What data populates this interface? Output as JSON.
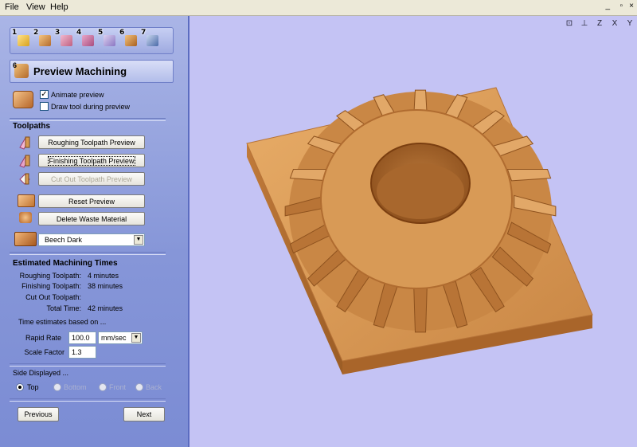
{
  "menu": {
    "items": [
      {
        "label": "File"
      },
      {
        "label": "View"
      },
      {
        "label": "Help"
      }
    ]
  },
  "toolbar": {
    "buttons": [
      {
        "number": "1",
        "icon": "open-file-icon"
      },
      {
        "number": "2",
        "icon": "job-setup-icon"
      },
      {
        "number": "3",
        "icon": "model-icon"
      },
      {
        "number": "4",
        "icon": "roughing-icon"
      },
      {
        "number": "5",
        "icon": "finishing-icon"
      },
      {
        "number": "6",
        "icon": "preview-icon"
      },
      {
        "number": "7",
        "icon": "save-icon"
      }
    ]
  },
  "header": {
    "number": "6",
    "title": "Preview Machining"
  },
  "options": {
    "animate_label": "Animate preview",
    "animate_checked": true,
    "draw_tool_label": "Draw tool during preview",
    "draw_tool_checked": false
  },
  "toolpaths": {
    "title": "Toolpaths",
    "roughing": "Roughing Toolpath Preview",
    "finishing": "Finishing Toolpath Preview",
    "cutout": "Cut Out Toolpath Preview",
    "reset": "Reset Preview",
    "delete_waste": "Delete Waste Material",
    "material": "Beech Dark"
  },
  "times": {
    "title": "Estimated Machining Times",
    "rows": [
      {
        "label": "Roughing Toolpath:",
        "value": "4 minutes"
      },
      {
        "label": "Finishing Toolpath:",
        "value": "38 minutes"
      },
      {
        "label": "Cut Out Toolpath:",
        "value": ""
      },
      {
        "label": "Total Time:",
        "value": "42 minutes"
      }
    ],
    "based_on": "Time estimates based on ...",
    "rapid_label": "Rapid Rate",
    "rapid_value": "100.0",
    "rapid_unit": "mm/sec",
    "scale_label": "Scale Factor",
    "scale_value": "1.3"
  },
  "side": {
    "title": "Side Displayed ...",
    "options": [
      {
        "label": "Top",
        "selected": true,
        "enabled": true
      },
      {
        "label": "Bottom",
        "selected": false,
        "enabled": false
      },
      {
        "label": "Front",
        "selected": false,
        "enabled": false
      },
      {
        "label": "Back",
        "selected": false,
        "enabled": false
      }
    ]
  },
  "nav": {
    "previous": "Previous",
    "next": "Next"
  },
  "viewport": {
    "tools": [
      {
        "icon": "zoom-all-icon",
        "glyph": "⊡"
      },
      {
        "icon": "iso-view-icon",
        "glyph": "⊥"
      },
      {
        "icon": "view-z-icon",
        "glyph": "Z"
      },
      {
        "icon": "view-x-icon",
        "glyph": "X"
      },
      {
        "icon": "view-y-icon",
        "glyph": "Y"
      }
    ]
  },
  "colors": {
    "panel_top": "#aab5e6",
    "panel_bottom": "#7b8cd4",
    "viewport_bg": "#c4c3f4",
    "wood": "#d49a52",
    "wood_dark": "#9a5b22"
  }
}
